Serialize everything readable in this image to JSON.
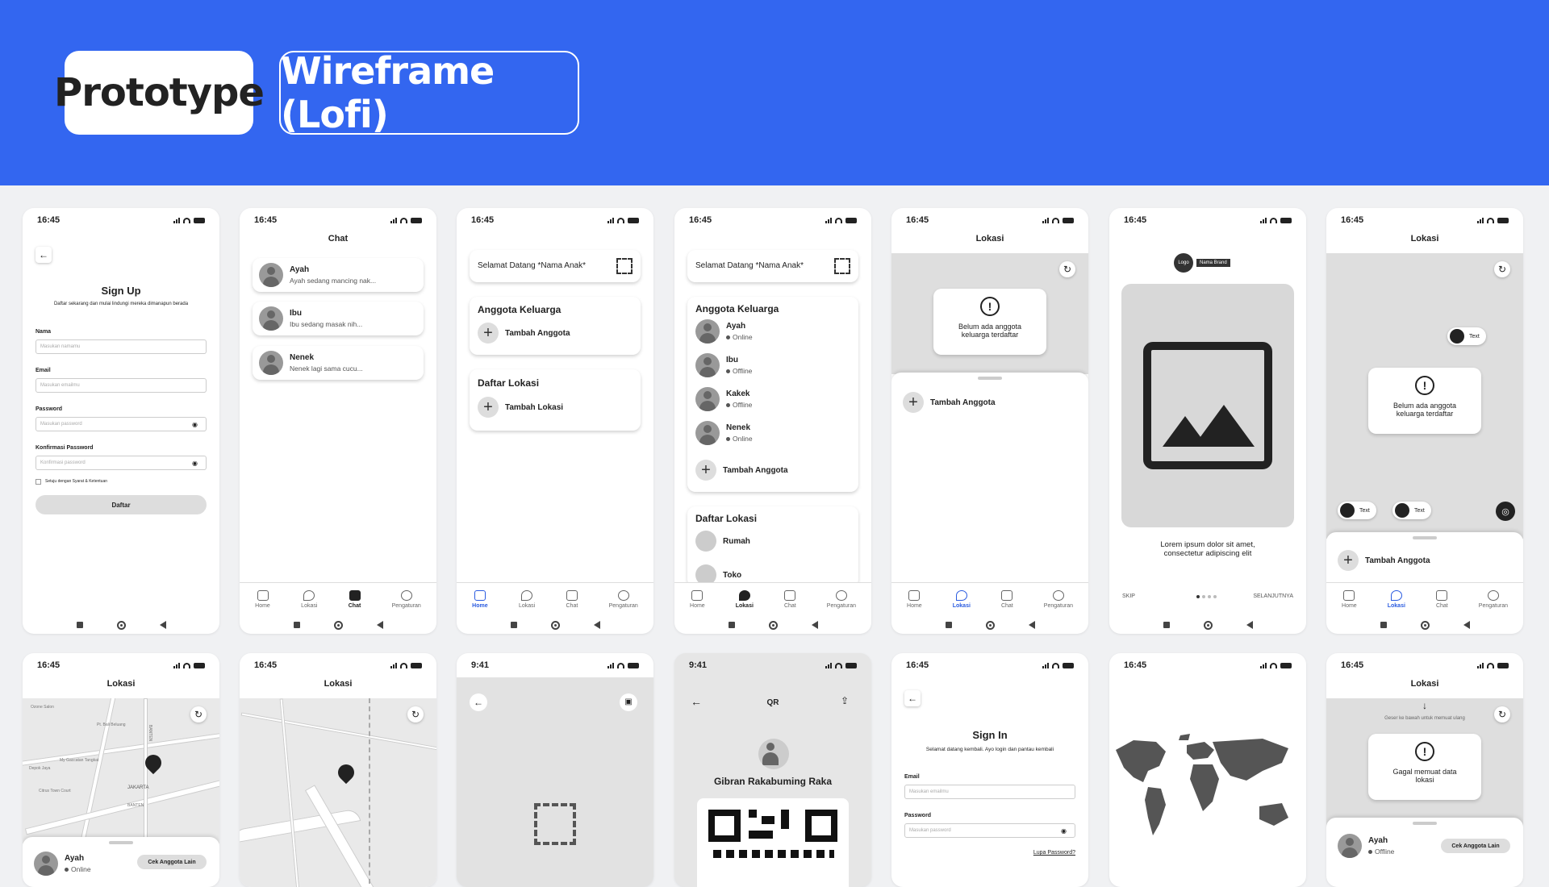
{
  "header": {
    "prototype_label": "Prototype",
    "wireframe_label": "Wireframe (Lofi)",
    "bg_color": "#3366f0"
  },
  "status": {
    "time": "16:45",
    "time_alt": "9:41"
  },
  "tabs": {
    "home": "Home",
    "lokasi": "Lokasi",
    "chat": "Chat",
    "pengaturan": "Pengaturan"
  },
  "signup": {
    "title": "Sign Up",
    "subtitle": "Daftar sekarang  dan mulai lindungi mereka dimanapun berada",
    "nama_label": "Nama",
    "nama_ph": "Masukan namamu",
    "email_label": "Email",
    "email_ph": "Masukan emailmu",
    "password_label": "Password",
    "password_ph": "Masukan password",
    "konfirmasi_label": "Konfirmasi Password",
    "konfirmasi_ph": "Konfirmasi password",
    "agree": "Setuju dengan Syarat & Ketentuan",
    "button": "Daftar"
  },
  "chat": {
    "title": "Chat",
    "items": [
      {
        "name": "Ayah",
        "msg": "Ayah sedang mancing nak..."
      },
      {
        "name": "Ibu",
        "msg": "Ibu sedang masak nih..."
      },
      {
        "name": "Nenek",
        "msg": "Nenek lagi sama cucu..."
      }
    ]
  },
  "home": {
    "welcome": "Selamat Datang *Nama Anak*",
    "anggota_title": "Anggota Keluarga",
    "tambah_anggota": "Tambah Anggota",
    "lokasi_title": "Daftar Lokasi",
    "tambah_lokasi": "Tambah Lokasi"
  },
  "home2": {
    "members": [
      {
        "name": "Ayah",
        "status": "Online"
      },
      {
        "name": "Ibu",
        "status": "Offline"
      },
      {
        "name": "Kakek",
        "status": "Offline"
      },
      {
        "name": "Nenek",
        "status": "Online"
      }
    ],
    "locations": [
      "Rumah",
      "Toko"
    ]
  },
  "lokasi": {
    "title": "Lokasi",
    "empty": "Belum ada anggota keluarga terdaftar",
    "chip_text": "Text",
    "error": "Gagal memuat data lokasi",
    "pull_hint": "Geser ke bawah untuk memuat ulang",
    "cek_button": "Cek Anggota Lain"
  },
  "onboarding": {
    "logo": "Logo",
    "brand": "Nama Brand",
    "text": "Lorem ipsum dolor sit amet, consectetur adipiscing elit",
    "skip": "SKIP",
    "next": "SELANJUTNYA"
  },
  "map": {
    "person": "Ayah",
    "status": "Online",
    "status_off": "Offline",
    "labels": [
      "Ozone Salon",
      "BANTEN",
      "Pt. Bali Beluang",
      "JAKARTA",
      "My Gaccatan Tangkat",
      "Depok Jaya",
      "Citrus Town Court",
      "BANTEN"
    ]
  },
  "qr": {
    "title": "QR",
    "name": "Gibran Rakabuming Raka"
  },
  "signin": {
    "title": "Sign In",
    "subtitle": "Selamat datang kembali.  Ayo login dan pantau kembali",
    "email_label": "Email",
    "email_ph": "Masukan emailmu",
    "password_label": "Password",
    "password_ph": "Masukan password",
    "forgot": "Lupa Password?"
  }
}
